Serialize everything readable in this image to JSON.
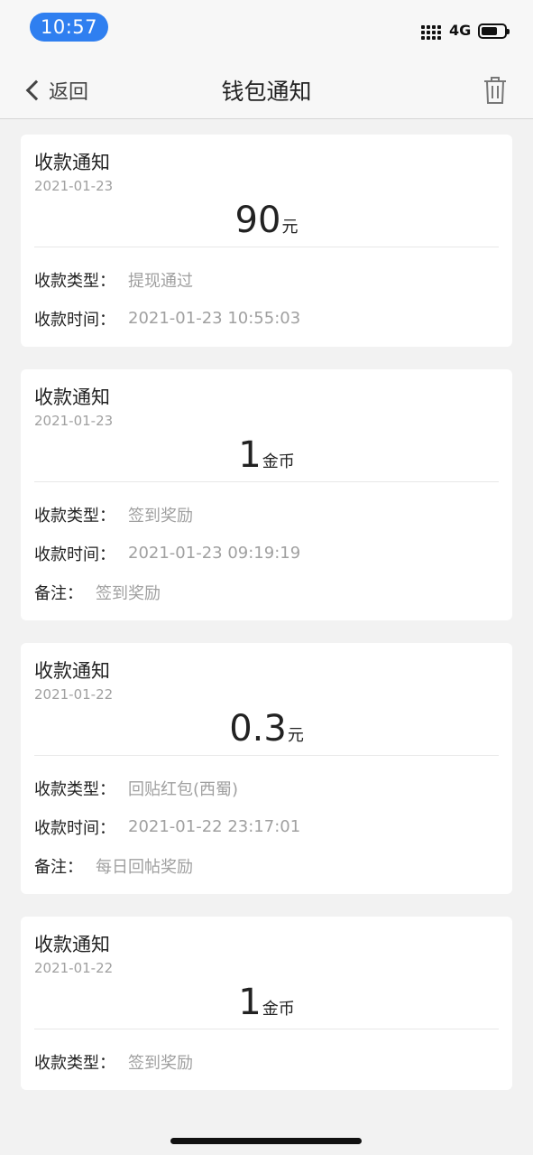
{
  "status_bar": {
    "time": "10:57",
    "network": "4G"
  },
  "nav": {
    "back_label": "返回",
    "title": "钱包通知"
  },
  "cards": [
    {
      "title": "收款通知",
      "date": "2021-01-23",
      "amount": "90",
      "unit": "元",
      "details": [
        {
          "label": "收款类型：",
          "value": "提现通过"
        },
        {
          "label": "收款时间：",
          "value": "2021-01-23 10:55:03"
        }
      ]
    },
    {
      "title": "收款通知",
      "date": "2021-01-23",
      "amount": "1",
      "unit": "金币",
      "details": [
        {
          "label": "收款类型：",
          "value": "签到奖励"
        },
        {
          "label": "收款时间：",
          "value": "2021-01-23 09:19:19"
        },
        {
          "label": "备注：",
          "value": "签到奖励"
        }
      ]
    },
    {
      "title": "收款通知",
      "date": "2021-01-22",
      "amount": "0.3",
      "unit": "元",
      "details": [
        {
          "label": "收款类型：",
          "value": "回贴红包(西蜀)"
        },
        {
          "label": "收款时间：",
          "value": "2021-01-22 23:17:01"
        },
        {
          "label": "备注：",
          "value": "每日回帖奖励"
        }
      ]
    },
    {
      "title": "收款通知",
      "date": "2021-01-22",
      "amount": "1",
      "unit": "金币",
      "details": [
        {
          "label": "收款类型：",
          "value": "签到奖励"
        }
      ]
    }
  ]
}
